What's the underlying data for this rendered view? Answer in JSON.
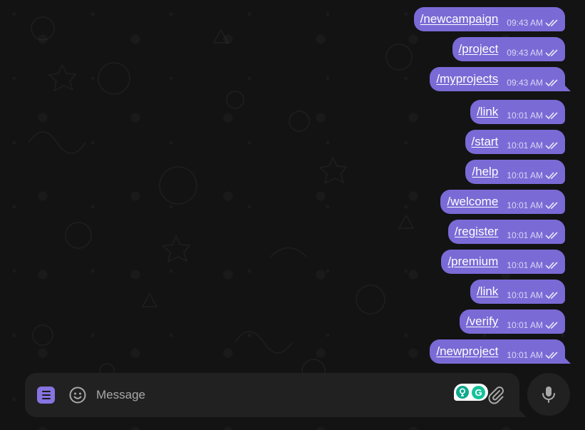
{
  "chat": {
    "messages": [
      {
        "text": "/newcampaign",
        "time": "09:43 AM",
        "status": "read"
      },
      {
        "text": "/project",
        "time": "09:43 AM",
        "status": "read"
      },
      {
        "text": "/myprojects",
        "time": "09:43 AM",
        "status": "read"
      },
      {
        "text": "/link",
        "time": "10:01 AM",
        "status": "read"
      },
      {
        "text": "/start",
        "time": "10:01 AM",
        "status": "read"
      },
      {
        "text": "/help",
        "time": "10:01 AM",
        "status": "read"
      },
      {
        "text": "/welcome",
        "time": "10:01 AM",
        "status": "read"
      },
      {
        "text": "/register",
        "time": "10:01 AM",
        "status": "read"
      },
      {
        "text": "/premium",
        "time": "10:01 AM",
        "status": "read"
      },
      {
        "text": "/link",
        "time": "10:01 AM",
        "status": "read"
      },
      {
        "text": "/verify",
        "time": "10:01 AM",
        "status": "read"
      },
      {
        "text": "/newproject",
        "time": "10:01 AM",
        "status": "read"
      }
    ]
  },
  "composer": {
    "placeholder": "Message",
    "value": "",
    "icons": {
      "menu": "bot-menu-icon",
      "emoji": "emoji-icon",
      "extension_a": "assistant-extension-icon",
      "extension_b": "grammarly-icon",
      "extension_b_glyph": "G",
      "attach": "paperclip-icon",
      "mic": "microphone-icon"
    }
  },
  "colors": {
    "bubble": "#7a6ad6",
    "background": "#131313",
    "composer": "#212121",
    "accent": "#8774e1"
  }
}
